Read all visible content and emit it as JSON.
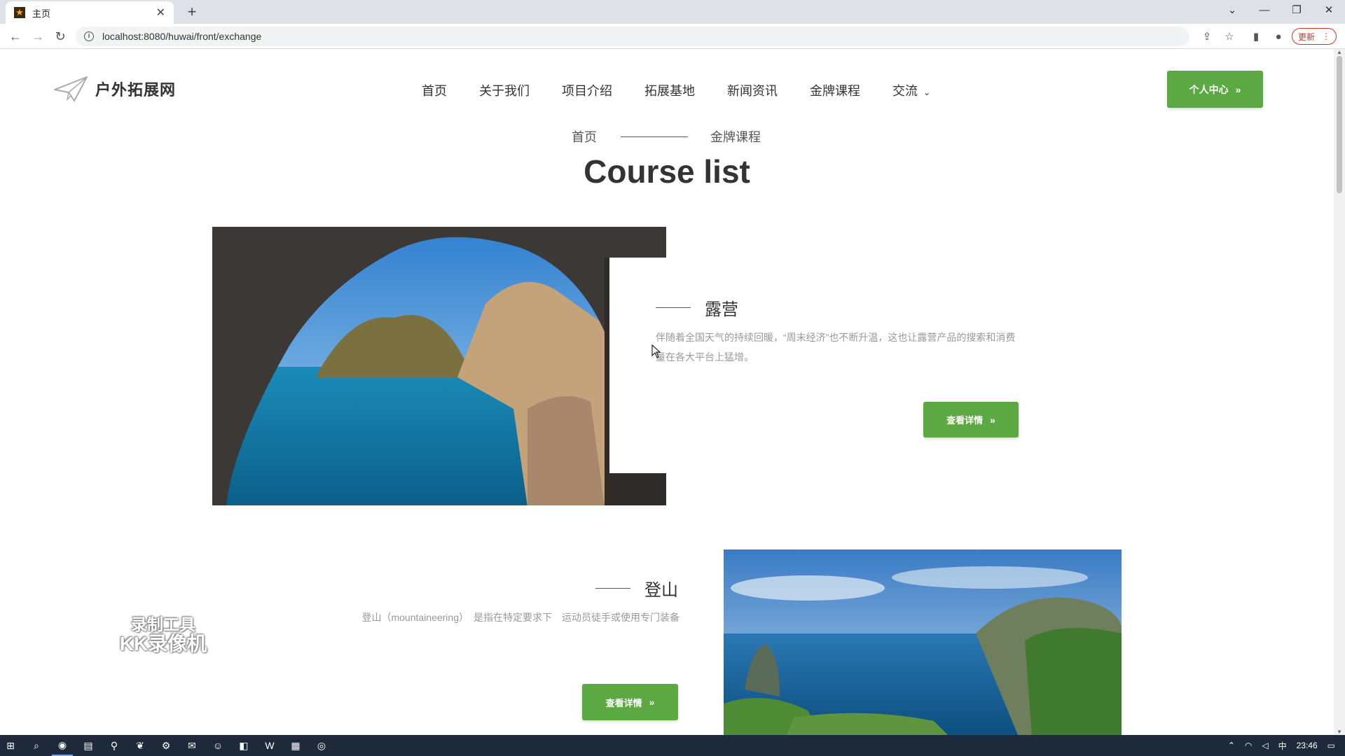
{
  "browser": {
    "tab_title": "主页",
    "tab_close": "✕",
    "new_tab": "+",
    "url": "localhost:8080/huwai/front/exchange",
    "update_label": "更新",
    "window_controls": [
      "⌄",
      "—",
      "❐",
      "✕"
    ]
  },
  "site": {
    "brand": "户外拓展网",
    "nav": [
      "首页",
      "关于我们",
      "项目介绍",
      "拓展基地",
      "新闻资讯",
      "金牌课程",
      "交流"
    ],
    "personal_center": "个人中心"
  },
  "breadcrumb": {
    "home": "首页",
    "current": "金牌课程"
  },
  "heading": "Course list",
  "courses": [
    {
      "title": "露营",
      "desc": "伴随着全国天气的持续回暖，“周末经济”也不断升温，这也让露营产品的搜索和消费量在各大平台上猛增。",
      "button": "查看详情"
    },
    {
      "title": "登山",
      "desc": "登山（mountaineering）　是指在特定要求下　运动员徒手或使用专门装备",
      "button": "查看详情"
    }
  ],
  "watermark": {
    "line1": "录制工具",
    "line2": "KK录像机"
  },
  "taskbar": {
    "ime": "中",
    "time": "23:46"
  },
  "colors": {
    "accent_green": "#5ca843",
    "update_red": "#d93025"
  },
  "icons": [
    "back-icon",
    "forward-icon",
    "reload-icon",
    "info-icon",
    "share-icon",
    "star-icon",
    "sidebar-icon",
    "profile-icon",
    "paper-plane-logo",
    "double-chevron-icon"
  ]
}
